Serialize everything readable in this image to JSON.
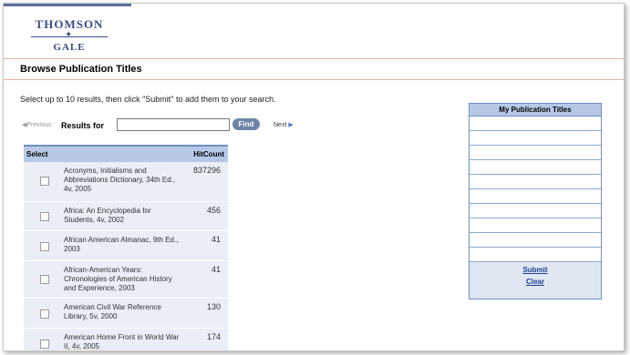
{
  "logo": {
    "line1": "THOMSON",
    "line2": "GALE"
  },
  "page_title": "Browse Publication Titles",
  "instructions": "Select up to 10  results, then click \"Submit\" to add them to your search.",
  "nav": {
    "previous": "Previous",
    "results_for": "Results for",
    "search_value": "",
    "find": "Find",
    "next": "Next"
  },
  "table": {
    "headers": [
      "Select",
      "HitCount"
    ],
    "rows": [
      {
        "title": "Acronyms, Initialisms and Abbreviations Dictionary, 34th Ed., 4v, 2005",
        "hits": "837296"
      },
      {
        "title": "Africa: An Encyclopedia for Students, 4v, 2002",
        "hits": "456"
      },
      {
        "title": "African American Almanac, 9th Ed., 2003",
        "hits": "41"
      },
      {
        "title": "African-American Years: Chronologies of American History and Experience, 2003",
        "hits": "41"
      },
      {
        "title": "American Civil War Reference Library, 5v, 2000",
        "hits": "130"
      },
      {
        "title": "American Home Front in World War II, 4v, 2005",
        "hits": "174"
      }
    ]
  },
  "panel": {
    "title": "My Publication Titles",
    "submit": "Submit",
    "clear": "Clear"
  },
  "colors": {
    "accent": "#3a4e86",
    "table_header": "#b7c8e6",
    "row_bg": "#e9eef7",
    "divider": "#e2b59a"
  }
}
